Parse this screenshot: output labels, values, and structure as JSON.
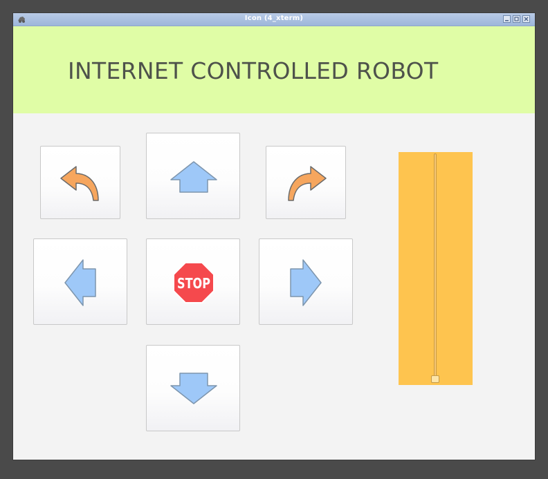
{
  "window": {
    "title": "Icon (4_xterm)"
  },
  "header": {
    "title": "INTERNET CONTROLLED ROBOT",
    "background": "#e0fda6"
  },
  "controls": {
    "turn_left": "turn-left-arrow-icon",
    "forward": "up-arrow-icon",
    "turn_right": "turn-right-arrow-icon",
    "left": "left-arrow-icon",
    "stop": {
      "icon": "stop-sign-icon",
      "label": "STOP"
    },
    "right": "right-arrow-icon",
    "backward": "down-arrow-icon"
  },
  "speed_slider": {
    "orientation": "vertical",
    "value_fraction": 0.0,
    "color": "#fec44f"
  },
  "colors": {
    "arrow_blue": "#9ec8f8",
    "curve_orange": "#f6a65e",
    "stop_red": "#f5494d"
  }
}
